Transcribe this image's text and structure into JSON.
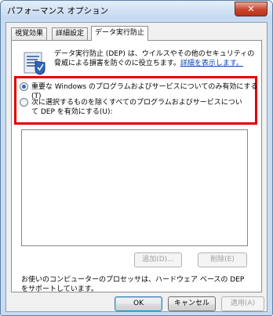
{
  "window": {
    "title": "パフォーマンス オプション",
    "close_label": "✕"
  },
  "tabs": [
    {
      "label": "視覚効果"
    },
    {
      "label": "詳細設定"
    },
    {
      "label": "データ実行防止"
    }
  ],
  "active_tab": "データ実行防止",
  "dep": {
    "description": "データ実行防止 (DEP) は、ウイルスやその他のセキュリティの脅威による損害を防ぐのに役立ちます。",
    "link": "詳細を表示します。",
    "options": [
      {
        "label": "重要な Windows のプログラムおよびサービスについてのみ有効にする(T)",
        "checked": true
      },
      {
        "label": "次に選択するものを除くすべてのプログラムおよびサービスについて DEP を有効にする(U):",
        "checked": false
      }
    ],
    "add_button": "追加(D)...",
    "remove_button": "削除(E)",
    "footer": "お使いのコンピューターのプロセッサは、ハードウェア ベースの DEP をサポートしています。"
  },
  "dialog_buttons": {
    "ok": "OK",
    "cancel": "キャンセル",
    "apply": "適用(A)"
  },
  "colors": {
    "highlight": "#e00000",
    "link": "#0645ad",
    "close_button": "#c8442b"
  }
}
